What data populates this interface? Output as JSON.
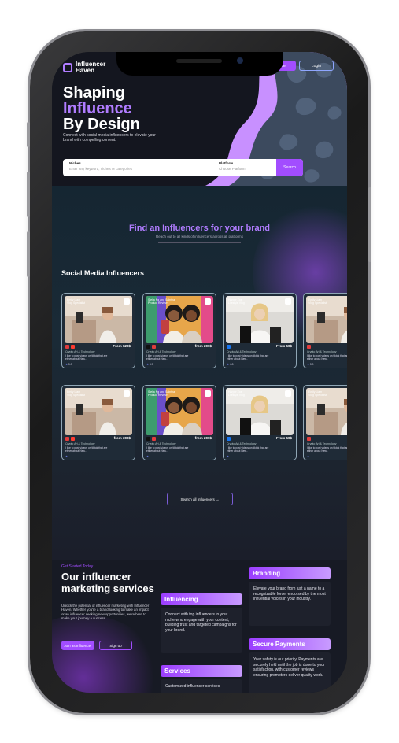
{
  "header": {
    "brand": "Influencer Haven",
    "brand_line1": "Influencer",
    "brand_line2": "Haven",
    "signup_label": "Sign Up as Influencer",
    "signup_label_short": "luencer",
    "login_label": "Login"
  },
  "hero": {
    "line1": "Shaping",
    "line2": "Influence",
    "line3": "By Design",
    "subtitle": "Connect with social media influencers to elevate your brand with compelling content.",
    "niches_label": "Niches",
    "niches_placeholder": "Enter any keyword, niches or categories",
    "platform_label": "Platform",
    "platform_placeholder": "Choose Platform",
    "search_label": "Search"
  },
  "find": {
    "title": "Find an  Influencers for your brand",
    "subtitle": "Reach out to all kinds of influencers across all platforms"
  },
  "section_title": "Social Media Influencers",
  "cards": [
    {
      "caption": "Emily Liam\nVlog Specialist",
      "price": "From $20$",
      "category": "Crypto Art & Technology",
      "desc": "I like to post videos on tiktok that are either about New..",
      "rating": "5.0",
      "socials": [
        "#e23d3d",
        "#ff3b30"
      ],
      "img": "a"
    },
    {
      "caption": "Stella Ng and Sabrina\nProduct Review",
      "price": "from 200$",
      "category": "Crypto Art & Technology",
      "desc": "I like to post videos on tiktok that are either about New..",
      "rating": "4.9",
      "socials": [
        "#111111",
        "#e23d3d"
      ],
      "img": "b"
    },
    {
      "caption": "Harper Zoe\nLifestyle Vlog",
      "price": "From 50$",
      "category": "Crypto Art & Technology",
      "desc": "I like to post videos on tiktok that are either about New..",
      "rating": "4.8",
      "socials": [
        "#1877f2"
      ],
      "img": "c"
    },
    {
      "caption": "Emily Liam\nVlog Specialist",
      "price": "",
      "category": "Crypto Art & Technology",
      "desc": "I like to post videos on tiktok that are either about New..",
      "rating": "5.0",
      "socials": [
        "#e23d3d"
      ],
      "img": "a"
    },
    {
      "caption": "Emily Liam\nVlog Specialist",
      "price": "from 300$",
      "category": "Crypto Art & Technology",
      "desc": "I like to post videos on tiktok that are either about New..",
      "rating": "",
      "socials": [
        "#e23d3d",
        "#ff3b30"
      ],
      "img": "a"
    },
    {
      "caption": "Stella Ng and Sabrina\nProduct Review",
      "price": "from 200$",
      "category": "Crypto Art & Technology",
      "desc": "I like to post videos on tiktok that are either about New..",
      "rating": "",
      "socials": [
        "#111111",
        "#e23d3d"
      ],
      "img": "b"
    },
    {
      "caption": "Harper Zoe\nLifestyle Vlog",
      "price": "From 50$",
      "category": "Crypto Art & Technology",
      "desc": "I like to post videos on tiktok that are either about New..",
      "rating": "",
      "socials": [
        "#1877f2"
      ],
      "img": "c"
    },
    {
      "caption": "Emily Liam\nVlog Specialist",
      "price": "",
      "category": "Crypto Art & Technology",
      "desc": "I like to post videos on tiktok that are either about New..",
      "rating": "",
      "socials": [
        "#e23d3d"
      ],
      "img": "a"
    }
  ],
  "search_all_label": "Search all Influencers  →",
  "services": {
    "eyebrow": "Get Started Today",
    "title": "Our influencer marketing services",
    "text": "Unlock the potential of influencer marketing with Influencer Haven. Whether you're a brand looking to make an impact or an influencer seeking new opportunities, we're here to make your journey a success.",
    "join_label": "Join as Influencer",
    "signup_label": "Sign up",
    "influencing_title": "Influencing",
    "influencing_text": "Connect with top influencers in your niche who engage with your content, building trust and targeted campaigns for your brand.",
    "services_title": "Services",
    "services_text": "Customized influencer services",
    "branding_title": "Branding",
    "branding_text": "Elevate your brand from just a name to a recognizable force, endorsed by the most influential voices in your industry.",
    "payments_title": "Secure Payments",
    "payments_text": "Your safety is our priority. Payments are securely held until the job is done to your satisfaction, with customer reviews ensuring promoters deliver quality work."
  },
  "colors": {
    "accent": "#a24dff",
    "lavender": "#b07cff",
    "bg": "#171a24"
  }
}
